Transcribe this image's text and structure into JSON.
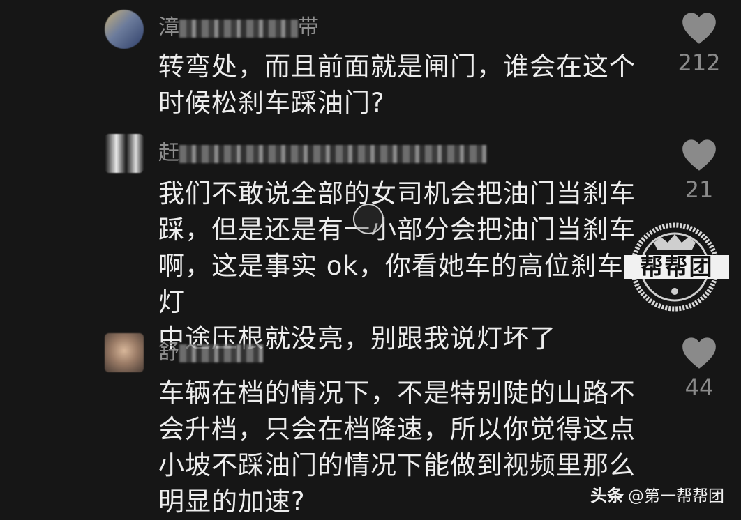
{
  "comments": [
    {
      "username_first": "漳",
      "username_last": "带",
      "text": "转弯处，而且前面就是闸门，谁会在这个\n时候松刹车踩油门?",
      "likes": "212"
    },
    {
      "username_first": "赶",
      "username_last": "",
      "text": "我们不敢说全部的女司机会把油门当刹车\n踩，但是还是有一小部分会把油门当刹车\n啊，这是事实 ok，你看她车的高位刹车灯\n中途压根就没亮，别跟我说灯坏了",
      "likes": "21"
    },
    {
      "username_first": "舒",
      "username_last": "",
      "text": "车辆在档的情况下，不是特别陡的山路不\n会升档，只会在档降速，所以你觉得这点\n小坡不踩油门的情况下能做到视频里那么\n明显的加速?",
      "likes": "44"
    }
  ],
  "stamp_label": "帮帮团",
  "watermark": {
    "brand": "头条",
    "account": "@第一帮帮团"
  },
  "colors": {
    "background": "#161616",
    "text": "#ededed",
    "secondary": "#8e8e8e",
    "heart": "#8a8a8a"
  },
  "icons": {
    "like": "heart-icon"
  }
}
